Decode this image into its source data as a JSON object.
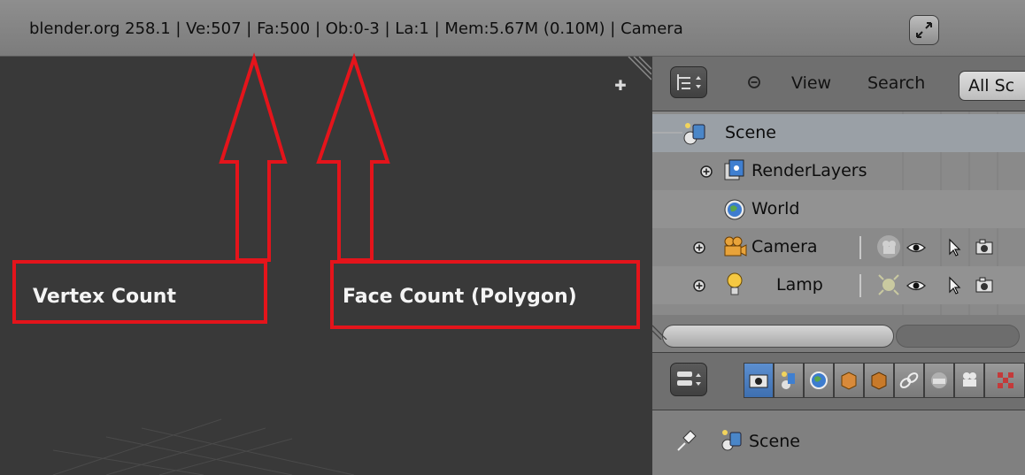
{
  "header": {
    "stats_text": "blender.org 258.1 | Ve:507 | Fa:500 | Ob:0-3 | La:1 | Mem:5.67M (0.10M) | Camera"
  },
  "outliner_header": {
    "view_label": "View",
    "search_label": "Search",
    "display_mode": "All Sc"
  },
  "outliner": {
    "rows": [
      {
        "label": "Scene",
        "icon": "scene-icon"
      },
      {
        "label": "RenderLayers",
        "icon": "renderlayers-icon"
      },
      {
        "label": "World",
        "icon": "world-icon"
      },
      {
        "label": "Camera",
        "icon": "camera-object-icon"
      },
      {
        "label": "Lamp",
        "icon": "lamp-object-icon"
      }
    ]
  },
  "properties": {
    "context_label": "Scene",
    "tabs": [
      "render-icon",
      "render-layers-icon",
      "scene-icon",
      "world-icon",
      "object-icon",
      "constraints-icon",
      "modifiers-icon",
      "material-icon"
    ]
  },
  "annotations": {
    "vertex_label": "Vertex Count",
    "face_label": "Face Count (Polygon)",
    "color": "#e4141b"
  }
}
